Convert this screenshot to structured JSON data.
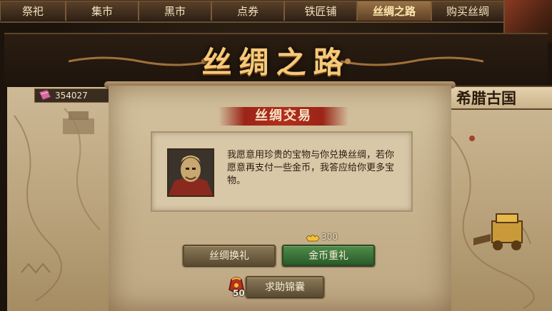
{
  "tabs": [
    {
      "label": "祭祀",
      "active": false
    },
    {
      "label": "集市",
      "active": false
    },
    {
      "label": "黑市",
      "active": false
    },
    {
      "label": "点券",
      "active": false
    },
    {
      "label": "铁匠铺",
      "active": false
    },
    {
      "label": "丝绸之路",
      "active": true
    },
    {
      "label": "购买丝绸",
      "active": false
    }
  ],
  "header": {
    "title": "丝绸之路"
  },
  "resources": {
    "silk": "354027",
    "silk_icon": "silk-bolt-icon"
  },
  "region": {
    "name": "希腊古国"
  },
  "trade": {
    "title": "丝绸交易",
    "dialog_text": "我愿意用珍贵的宝物与你兑换丝绸，若你愿意再支付一些金币，我答应给你更多宝物。",
    "gold_cost": "300",
    "buttons": {
      "silk_gift": "丝绸换礼",
      "gold_gift": "金币重礼",
      "help": "求助锦囊"
    },
    "help_count": "50"
  },
  "colors": {
    "accent_gold": "#f5c979",
    "title_red": "#b22d1e",
    "gold_button": "#4f8c4a"
  }
}
